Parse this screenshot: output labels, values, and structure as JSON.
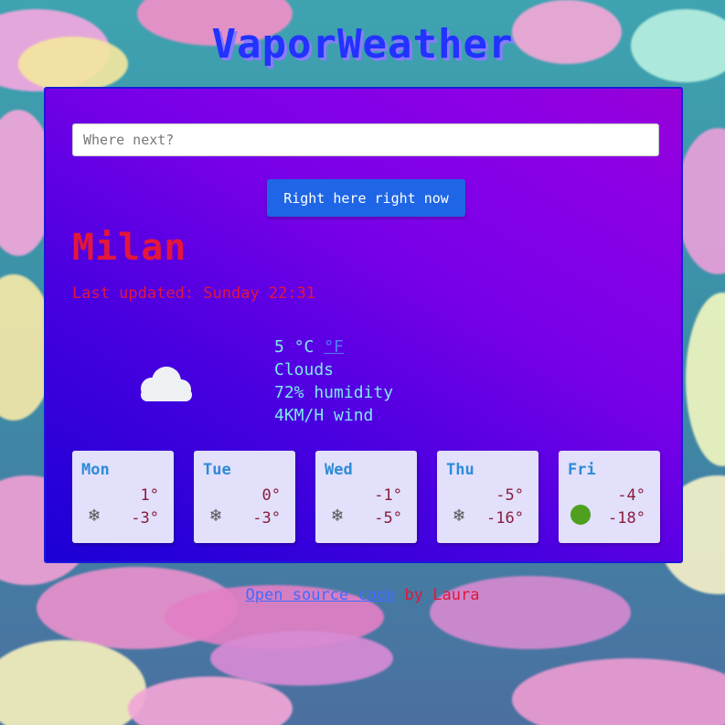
{
  "app": {
    "title": "VaporWeather"
  },
  "search": {
    "placeholder": "Where next?",
    "value": ""
  },
  "locate_button": {
    "label": "Right here right now"
  },
  "city": {
    "name": "Milan"
  },
  "last_updated": {
    "text": "Last updated: Sunday 22:31"
  },
  "current": {
    "temperature": "5",
    "unit_celsius": "°C",
    "unit_fahrenheit": "°F",
    "description": "Clouds",
    "humidity": "72% humidity",
    "wind": "4KM/H wind",
    "icon": "cloud-icon"
  },
  "forecast": [
    {
      "day": "Mon",
      "high": "1°",
      "low": "-3°",
      "icon": "snowflake-icon"
    },
    {
      "day": "Tue",
      "high": "0°",
      "low": "-3°",
      "icon": "snowflake-icon"
    },
    {
      "day": "Wed",
      "high": "-1°",
      "low": "-5°",
      "icon": "snowflake-icon"
    },
    {
      "day": "Thu",
      "high": "-5°",
      "low": "-16°",
      "icon": "snowflake-icon"
    },
    {
      "day": "Fri",
      "high": "-4°",
      "low": "-18°",
      "icon": "sun-icon"
    }
  ],
  "footer": {
    "link_label": "Open source code",
    "by_text": " by Laura"
  },
  "colors": {
    "title": "#2233ff",
    "city": "#e3163b",
    "info": "#7ee8f0",
    "button": "#1f66e6",
    "card_bg_start": "#1a00d6",
    "card_bg_end": "#9600d8"
  }
}
